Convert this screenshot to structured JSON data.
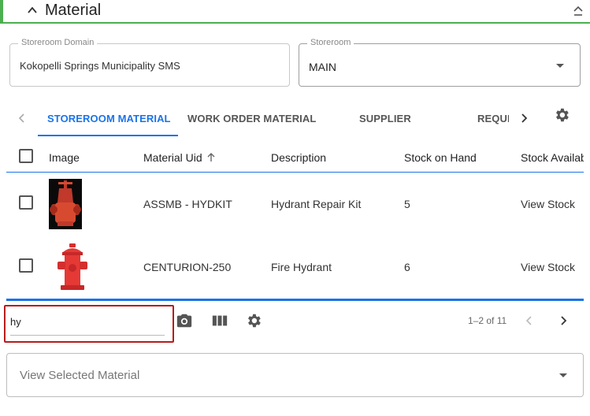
{
  "section": {
    "title": "Material"
  },
  "fields": {
    "domain": {
      "label": "Storeroom Domain",
      "value": "Kokopelli Springs Municipality SMS"
    },
    "storeroom": {
      "label": "Storeroom",
      "value": "MAIN"
    }
  },
  "tabs": [
    {
      "label": "STOREROOM MATERIAL",
      "active": true
    },
    {
      "label": "WORK ORDER MATERIAL",
      "active": false
    },
    {
      "label": "SUPPLIER",
      "active": false
    },
    {
      "label": "REQUI",
      "active": false
    }
  ],
  "grid": {
    "columns": [
      "Image",
      "Material Uid",
      "Description",
      "Stock on Hand",
      "Stock Availab"
    ],
    "rows": [
      {
        "image": "gate-valve-image",
        "uid": "ASSMB - HYDKIT",
        "description": "Hydrant Repair Kit",
        "stock": "5",
        "available": "View Stock"
      },
      {
        "image": "fire-hydrant-image",
        "uid": "CENTURION-250",
        "description": "Fire Hydrant",
        "stock": "6",
        "available": "View Stock"
      }
    ]
  },
  "search": {
    "value": "hy"
  },
  "pager": {
    "text": "1–2 of 11"
  },
  "view_selected": {
    "placeholder": "View Selected Material"
  },
  "colors": {
    "accent": "#1a73e8",
    "section_green": "#4caf50",
    "search_border": "#b71c1c",
    "hydrant_red": "#d32f2f"
  },
  "icons": [
    "chevron-up-icon",
    "collapse-icon",
    "chevron-left-icon",
    "chevron-right-icon",
    "gear-icon",
    "camera-icon",
    "columns-icon",
    "sort-up-icon",
    "dropdown-caret-icon"
  ]
}
